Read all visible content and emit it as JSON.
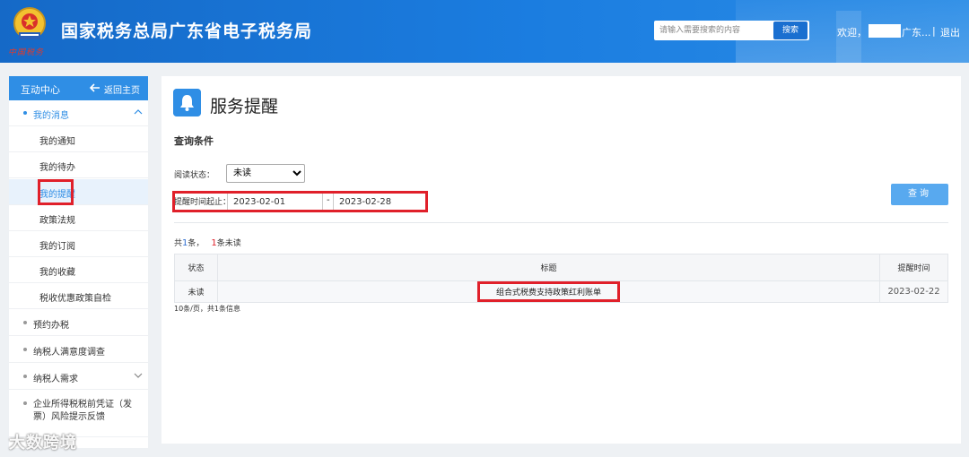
{
  "header": {
    "brand_script": "中国税务",
    "title": "国家税务总局广东省电子税务局",
    "search_placeholder": "请输入需要搜索的内容",
    "search_button": "搜索",
    "welcome": "欢迎，",
    "user_suffix": "广东...",
    "separator": "|",
    "logout": "退出"
  },
  "sidebar": {
    "header_title": "互动中心",
    "back_home": "返回主页",
    "group_messages": "我的消息",
    "sub_items": [
      "我的通知",
      "我的待办",
      "我的提醒",
      "政策法规",
      "我的订阅",
      "我的收藏",
      "税收优惠政策自检"
    ],
    "items": [
      "预约办税",
      "纳税人满意度调查",
      "纳税人需求",
      "企业所得税税前凭证（发票）风险提示反馈"
    ]
  },
  "main": {
    "page_title": "服务提醒",
    "section_title": "查询条件",
    "read_status_label": "阅读状态：",
    "read_status_value": "未读",
    "time_range_label": "提醒时间起止：",
    "date_from": "2023-02-01",
    "date_dash": "-",
    "date_to": "2023-02-28",
    "query_button": "查询",
    "summary": {
      "prefix": "共",
      "total": "1",
      "mid": "条，",
      "unread": "1",
      "suffix": "条未读"
    },
    "table": {
      "headers": [
        "状态",
        "标题",
        "提醒时间"
      ],
      "rows": [
        {
          "status": "未读",
          "title": "组合式税费支持政策红利账单",
          "time": "2023-02-22"
        }
      ]
    },
    "pager": "10条/页，共1条信息"
  },
  "watermark": "大数跨境",
  "colors": {
    "header_blue": "#1b7de0",
    "accent": "#2f8ee5",
    "highlight_red": "#e0202a",
    "query_button": "#58a9ef"
  }
}
